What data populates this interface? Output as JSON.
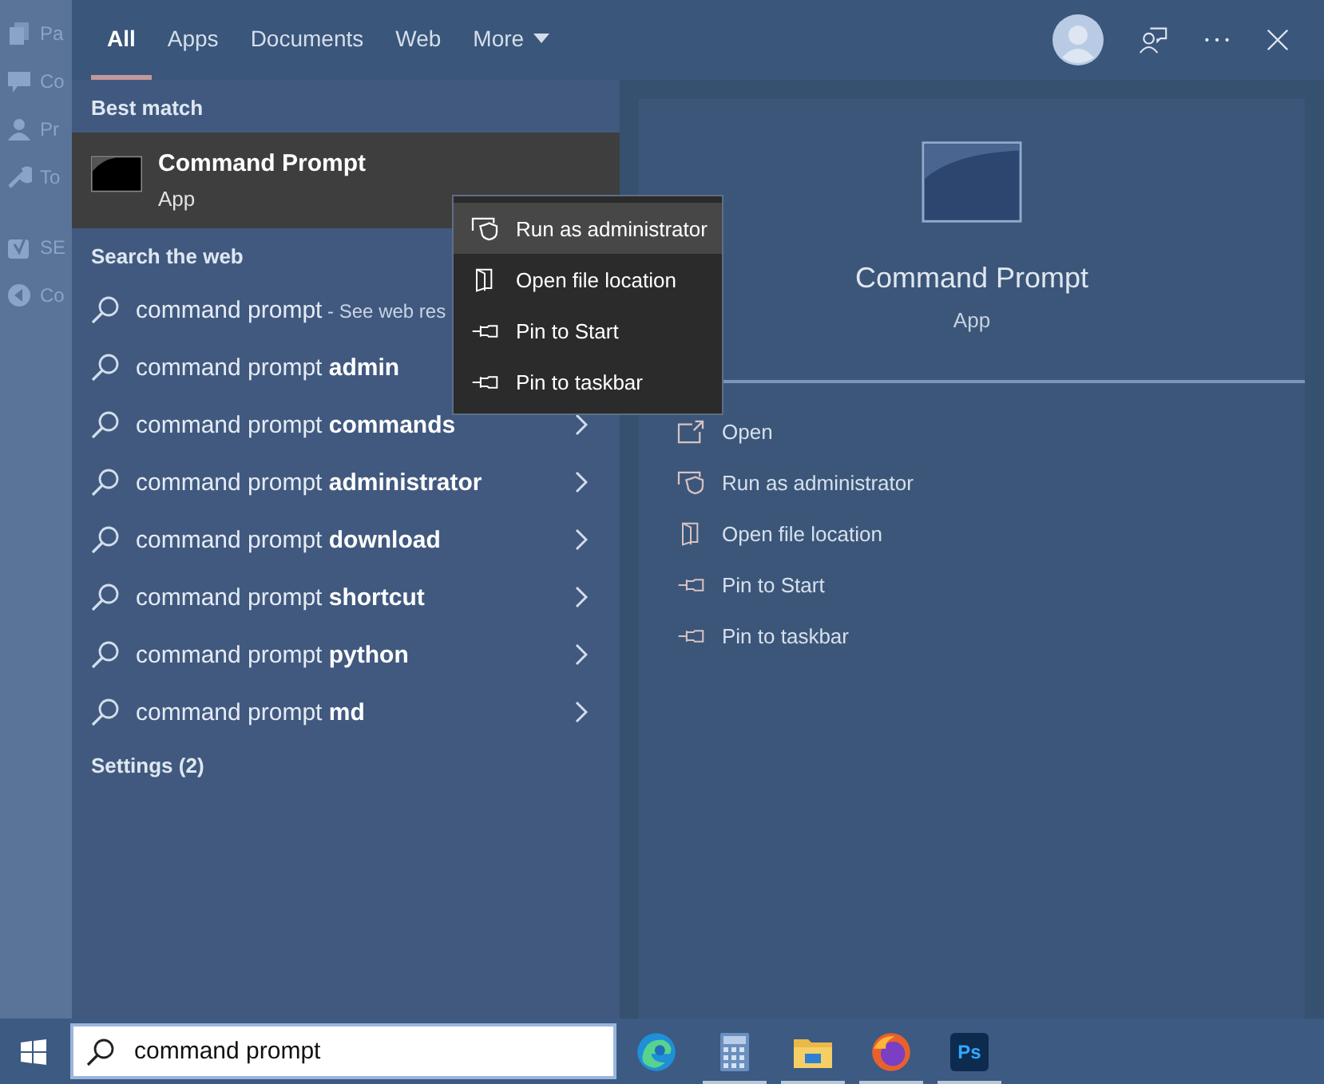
{
  "background_sidebar": {
    "items": [
      {
        "kind": "pages",
        "label": "Pa"
      },
      {
        "kind": "comment",
        "label": "Co"
      },
      {
        "kind": "profile",
        "label": "Pr"
      },
      {
        "kind": "tools",
        "label": "To"
      },
      {
        "kind": "seo",
        "label": "SE"
      },
      {
        "kind": "collapse",
        "label": "Co"
      }
    ]
  },
  "tabs": [
    {
      "label": "All",
      "selected": true,
      "dropdown": false
    },
    {
      "label": "Apps",
      "selected": false,
      "dropdown": false
    },
    {
      "label": "Documents",
      "selected": false,
      "dropdown": false
    },
    {
      "label": "Web",
      "selected": false,
      "dropdown": false
    },
    {
      "label": "More",
      "selected": false,
      "dropdown": true
    }
  ],
  "results": {
    "best_match_heading": "Best match",
    "best_match": {
      "title": "Command Prompt",
      "subtitle": "App",
      "selected": true
    },
    "web_heading": "Search the web",
    "web_results": [
      {
        "text": "command prompt",
        "hint": "- See web res",
        "chevron": false
      },
      {
        "text": "command prompt **admin**",
        "chevron": false
      },
      {
        "text": "command prompt **commands**",
        "chevron": true
      },
      {
        "text": "command prompt **administrator**",
        "chevron": true
      },
      {
        "text": "command prompt **download**",
        "chevron": true
      },
      {
        "text": "command prompt **shortcut**",
        "chevron": true
      },
      {
        "text": "command prompt **python**",
        "chevron": true
      },
      {
        "text": "command prompt **md**",
        "chevron": true
      }
    ],
    "settings_heading": "Settings (2)"
  },
  "context_menu": {
    "items": [
      {
        "kind": "shield",
        "label": "Run as administrator",
        "selected": true
      },
      {
        "kind": "folder",
        "label": "Open file location",
        "selected": false
      },
      {
        "kind": "pin",
        "label": "Pin to Start",
        "selected": false
      },
      {
        "kind": "pin",
        "label": "Pin to taskbar",
        "selected": false
      }
    ]
  },
  "preview": {
    "title": "Command Prompt",
    "subtitle": "App",
    "actions": [
      {
        "kind": "open",
        "label": "Open"
      },
      {
        "kind": "shield",
        "label": "Run as administrator"
      },
      {
        "kind": "folder",
        "label": "Open file location"
      },
      {
        "kind": "pin",
        "label": "Pin to Start"
      },
      {
        "kind": "pin",
        "label": "Pin to taskbar"
      }
    ]
  },
  "taskbar": {
    "search": {
      "value": "command prompt"
    },
    "apps": [
      {
        "kind": "edge",
        "running": false
      },
      {
        "kind": "calculator",
        "running": true
      },
      {
        "kind": "explorer",
        "running": true
      },
      {
        "kind": "firefox",
        "running": true
      },
      {
        "kind": "photoshop",
        "label": "Ps",
        "running": true
      }
    ]
  }
}
